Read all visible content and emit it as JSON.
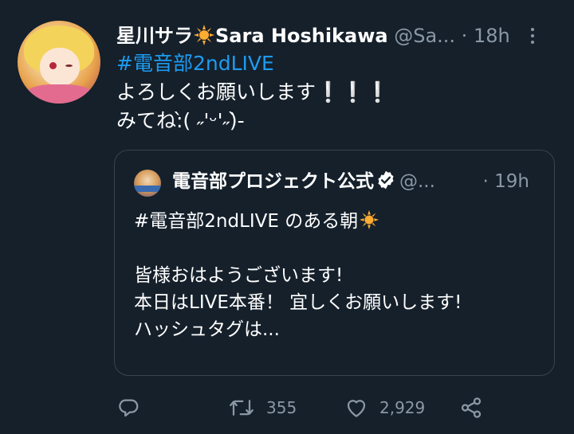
{
  "tweet": {
    "author_name": "星川サラ",
    "author_name_suffix": "Sara Hoshikawa",
    "handle": "@Sa...",
    "dot": "·",
    "time": "18h",
    "hashtag": "#電音部2ndLIVE",
    "line1": "よろしくお願いします❕❕❕",
    "line2": "みてね:̀( ˶'ᵕ'˶)̀-"
  },
  "quote": {
    "name": "電音部プロジェクト公式",
    "handle": "@...",
    "dot": "·",
    "time": "19h",
    "line1": "#電音部2ndLIVE のある朝",
    "line2": "皆様おはようございます!",
    "line3": "本日はLIVE本番！ 宜しくお願いします!",
    "line4": "ハッシュタグは..."
  },
  "actions": {
    "retweets": "355",
    "likes": "2,929"
  },
  "colors": {
    "background": "#15202b",
    "accent": "#1d9bf0",
    "secondary_text": "#8b98a5",
    "border": "#38444d"
  },
  "icons": [
    "more-icon",
    "sun-emoji-icon",
    "verified-icon",
    "reply-icon",
    "retweet-icon",
    "like-icon",
    "share-icon"
  ]
}
